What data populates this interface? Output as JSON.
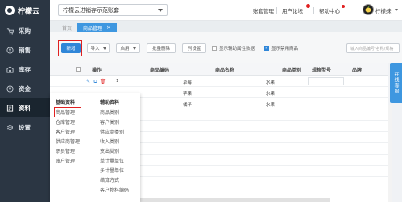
{
  "app": {
    "logo_text": "柠檬云"
  },
  "sidebar": {
    "items": [
      {
        "label": "采购",
        "icon": "cart-icon"
      },
      {
        "label": "销售",
        "icon": "sales-icon"
      },
      {
        "label": "库存",
        "icon": "warehouse-icon"
      },
      {
        "label": "资金",
        "icon": "money-icon"
      },
      {
        "label": "资料",
        "icon": "data-icon",
        "active": true
      },
      {
        "label": "设置",
        "icon": "gear-icon"
      }
    ]
  },
  "topbar": {
    "company": "柠檬云进销存示范账套",
    "links": [
      "账套管理",
      "用户论坛",
      "帮助中心"
    ],
    "user_name": "柠檬妹"
  },
  "tabs": [
    {
      "label": "首页",
      "active": false
    },
    {
      "label": "商品管理",
      "active": true
    }
  ],
  "toolbar": {
    "add": "新增",
    "import": "导入",
    "enable": "启用",
    "batch_delete": "批量删除",
    "column_settings": "列设置",
    "show_aux": "显示辅助属性数据",
    "show_disabled": "显示禁用商品",
    "search_placeholder": "输入商品编号/名称/规格"
  },
  "grid": {
    "columns": [
      "操作",
      "商品编码",
      "商品名称",
      "商品类别",
      "规格型号",
      "品牌"
    ],
    "rows": [
      {
        "code": "1",
        "name": "草莓",
        "category": "水果"
      },
      {
        "code": "",
        "name": "苹果",
        "category": "水果"
      },
      {
        "code": "",
        "name": "橘子",
        "category": "水果"
      }
    ]
  },
  "side_float": {
    "label": "在线客服"
  },
  "submenu": {
    "basic": {
      "title": "基础资料",
      "items": [
        "商品管理",
        "仓库管理",
        "客户管理",
        "供应商管理",
        "职员管理",
        "账户管理"
      ]
    },
    "aux": {
      "title": "辅助资料",
      "items": [
        "商品类别",
        "客户类别",
        "供应商类别",
        "收入类别",
        "支出类别",
        "单计量单位",
        "多计量单位",
        "结算方式",
        "客户物料编码"
      ]
    }
  },
  "colors": {
    "sidebar_bg": "#2b3643",
    "accent": "#2f86d8",
    "highlight": "#e02020"
  }
}
